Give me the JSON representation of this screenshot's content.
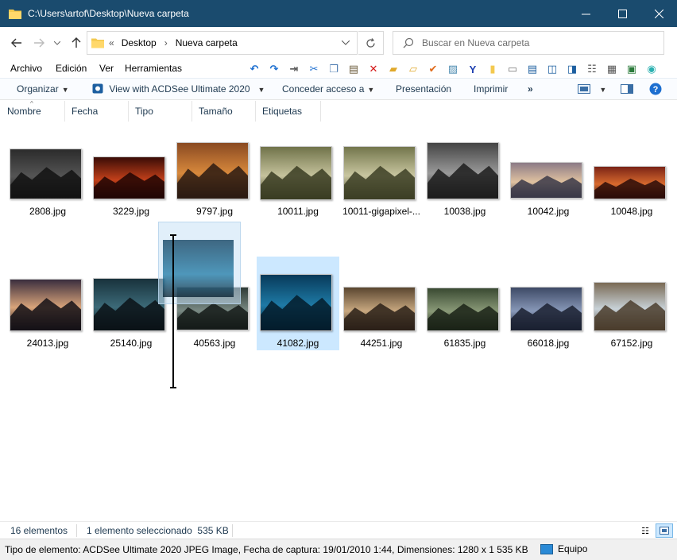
{
  "window": {
    "title": "C:\\Users\\artof\\Desktop\\Nueva carpeta"
  },
  "address": {
    "overflow": "«",
    "crumbs": [
      "Desktop",
      "Nueva carpeta"
    ]
  },
  "search": {
    "placeholder": "Buscar en Nueva carpeta"
  },
  "menu": [
    "Archivo",
    "Edición",
    "Ver",
    "Herramientas"
  ],
  "commands": {
    "organize": "Organizar",
    "acdsee": "View with ACDSee Ultimate 2020",
    "share": "Conceder acceso a",
    "slideshow": "Presentación",
    "print": "Imprimir",
    "more": "»"
  },
  "columns": [
    "Nombre",
    "Fecha",
    "Tipo",
    "Tamaño",
    "Etiquetas"
  ],
  "files": [
    {
      "name": "2808.jpg",
      "colors": [
        "#2b2b2b",
        "#555555",
        "#121212"
      ]
    },
    {
      "name": "3229.jpg",
      "colors": [
        "#3a0c06",
        "#c2401a",
        "#200503"
      ]
    },
    {
      "name": "9797.jpg",
      "colors": [
        "#8a4a22",
        "#d8893c",
        "#2a1a12"
      ]
    },
    {
      "name": "10011.jpg",
      "colors": [
        "#70734a",
        "#c5c29c",
        "#3a3c22"
      ]
    },
    {
      "name": "10011-gigapixel-...",
      "colors": [
        "#73764c",
        "#c9c6a0",
        "#3c3e24"
      ]
    },
    {
      "name": "10038.jpg",
      "colors": [
        "#444444",
        "#9a9a9a",
        "#1c1c1c"
      ]
    },
    {
      "name": "10042.jpg",
      "colors": [
        "#8c7b86",
        "#e0c2a0",
        "#3a3848"
      ]
    },
    {
      "name": "10048.jpg",
      "colors": [
        "#7a2416",
        "#d86a2e",
        "#2a0c08"
      ]
    },
    {
      "name": "24013.jpg",
      "colors": [
        "#3a2e3e",
        "#d9a47a",
        "#141016"
      ]
    },
    {
      "name": "25140.jpg",
      "colors": [
        "#18323c",
        "#3c6a78",
        "#0a1216"
      ]
    },
    {
      "name": "40563.jpg",
      "colors": [
        "#2e3a36",
        "#7a8a84",
        "#141a18"
      ]
    },
    {
      "name": "41082.jpg",
      "colors": [
        "#083a5a",
        "#1e7aa6",
        "#041c2c"
      ]
    },
    {
      "name": "44251.jpg",
      "colors": [
        "#5a4630",
        "#c8a880",
        "#2a2018"
      ]
    },
    {
      "name": "61835.jpg",
      "colors": [
        "#3a4a32",
        "#8a9a78",
        "#1a2216"
      ]
    },
    {
      "name": "66018.jpg",
      "colors": [
        "#3e4a66",
        "#8898b8",
        "#1a2030"
      ]
    },
    {
      "name": "67152.jpg",
      "colors": [
        "#7a6a54",
        "#c8d2d8",
        "#4a3c2c"
      ]
    }
  ],
  "status": {
    "count": "16 elementos",
    "selection": "1 elemento seleccionado  535 KB"
  },
  "details": "Tipo de elemento: ACDSee Ultimate 2020 JPEG Image, Fecha de captura: 19/01/2010 1:44, Dimensiones: 1280 x 1 535 KB",
  "computer": "Equipo",
  "accent": "#1a4b6e",
  "selection_color": "#cce8ff"
}
